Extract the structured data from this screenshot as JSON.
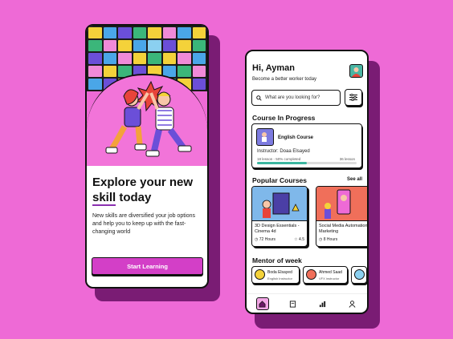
{
  "onboarding": {
    "headline_line1": "Explore your new",
    "headline_skill": "skill",
    "headline_rest": " today",
    "description": "New skills are diversified your job options and help you to keep up with the fast-changing world",
    "start_button": "Start Learning"
  },
  "home": {
    "greeting": "Hi, Ayman",
    "subtitle": "Become a better worker today",
    "search_placeholder": "What are you looking for?",
    "course_in_progress_title": "Course In Progress",
    "in_progress": {
      "title": "English Course",
      "instructor": "Instructor: Doaa Elsayed",
      "completed": "18 lesson - 50% completed",
      "total": "36 lesson",
      "progress": 0.5
    },
    "popular_title": "Popular Courses",
    "see_all": "See all",
    "courses": [
      {
        "title": "3D Design Essentials - Cinema 4d",
        "hours": "72 Hours",
        "rating": "4.5"
      },
      {
        "title": "Social Media Automation Marketing",
        "hours": "8 Hours",
        "rating": ""
      }
    ],
    "mentor_title": "Mentor of week",
    "mentors": [
      {
        "name": "Boda Elsayed",
        "role": "English Instructor"
      },
      {
        "name": "Ahmed Saad",
        "role": "VFX instructor"
      }
    ]
  },
  "colors": {
    "background": "#ee6ad6",
    "accent": "#d33fc7",
    "progress": "#3bb6a0"
  }
}
